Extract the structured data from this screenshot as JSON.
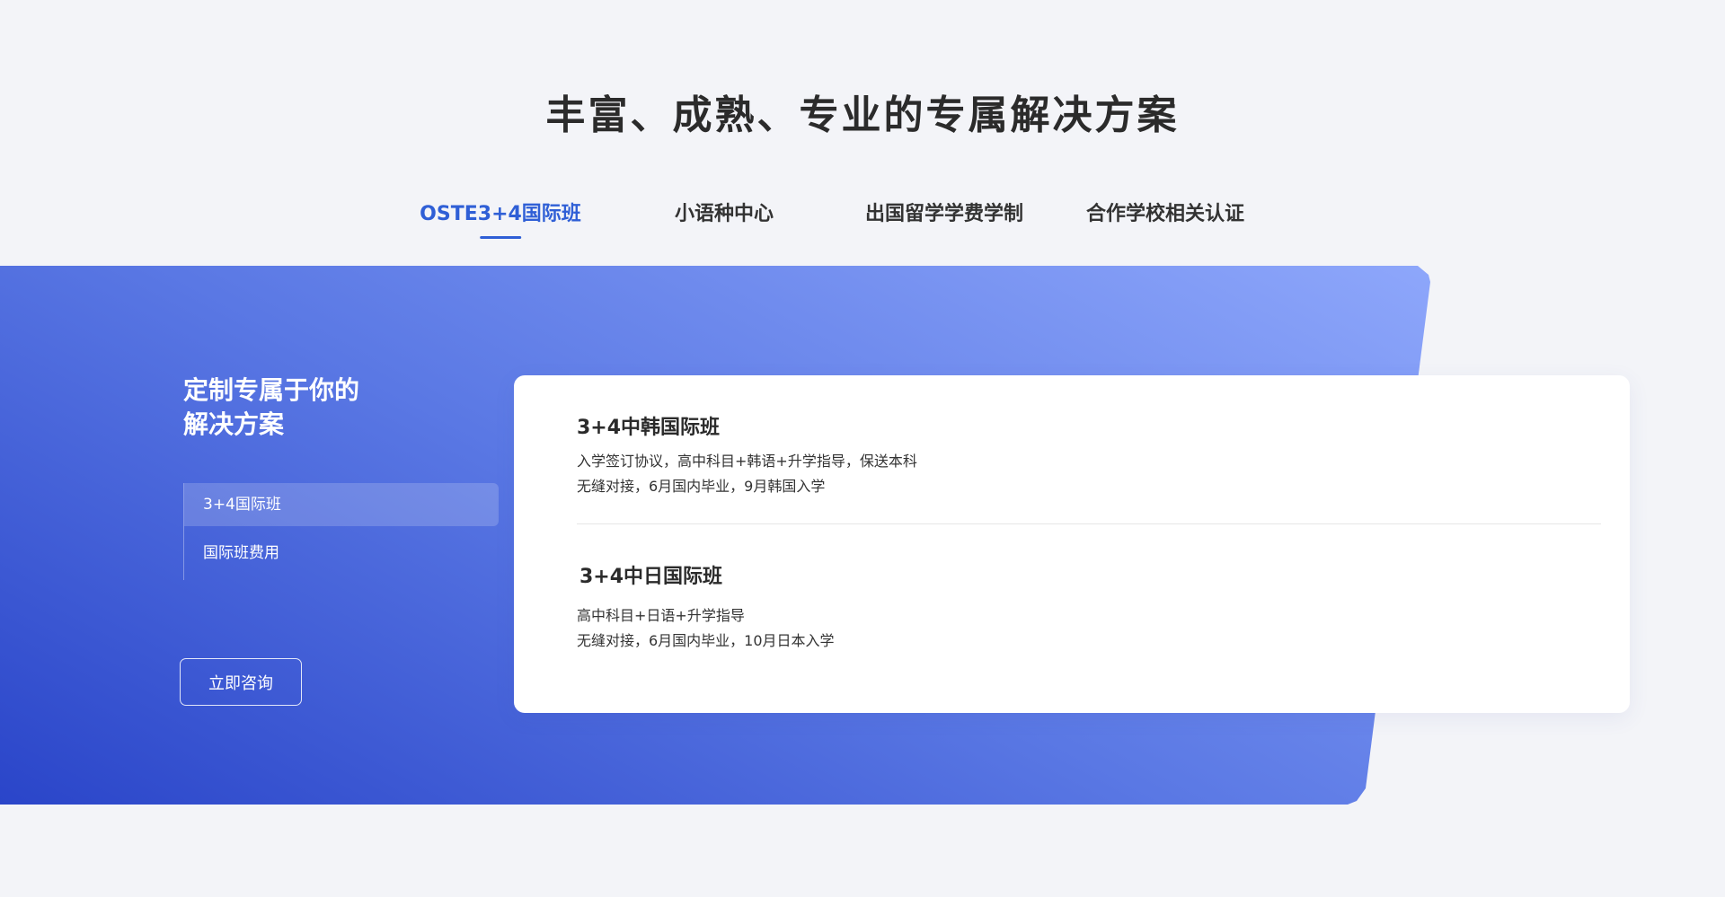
{
  "section": {
    "title": "丰富、成熟、专业的专属解决方案"
  },
  "tabs": [
    {
      "label": "OSTE3+4国际班",
      "active": true
    },
    {
      "label": "小语种中心",
      "active": false
    },
    {
      "label": "出国留学学费学制",
      "active": false
    },
    {
      "label": "合作学校相关认证",
      "active": false
    }
  ],
  "sidebar": {
    "heading_line1": "定制专属于你的",
    "heading_line2": "解决方案",
    "items": [
      {
        "label": "3+4国际班",
        "active": true
      },
      {
        "label": "国际班费用",
        "active": false
      }
    ],
    "consult_label": "立即咨询"
  },
  "programs": [
    {
      "title": "3+4中韩国际班",
      "lines": [
        "入学签订协议，高中科目+韩语+升学指导，保送本科",
        "无缝对接，6月国内毕业，9月韩国入学"
      ]
    },
    {
      "title": "3+4中日国际班",
      "lines": [
        "高中科目+日语+升学指导",
        "无缝对接，6月国内毕业，10月日本入学"
      ]
    }
  ],
  "colors": {
    "accent": "#2f5fd6",
    "banner_start": "#2a45c9",
    "banner_end": "#8ea7fb",
    "background": "#f3f4f8"
  }
}
